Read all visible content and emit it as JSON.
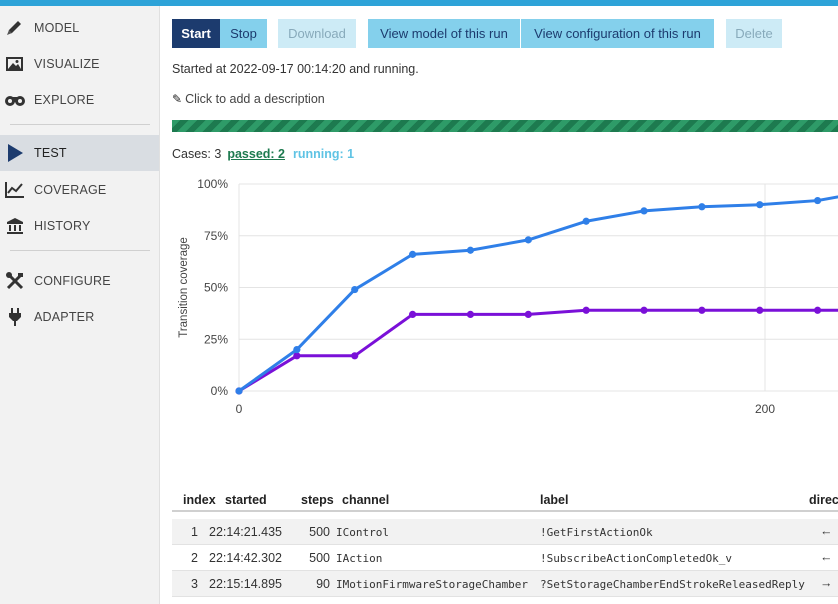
{
  "sidebar": {
    "items": [
      {
        "label": "MODEL",
        "icon": "pencil-icon"
      },
      {
        "label": "VISUALIZE",
        "icon": "image-icon"
      },
      {
        "label": "EXPLORE",
        "icon": "binoculars-icon"
      },
      {
        "label": "TEST",
        "icon": "play-icon",
        "active": true
      },
      {
        "label": "COVERAGE",
        "icon": "line-chart-icon"
      },
      {
        "label": "HISTORY",
        "icon": "bank-icon"
      },
      {
        "label": "CONFIGURE",
        "icon": "tools-icon"
      },
      {
        "label": "ADAPTER",
        "icon": "plug-icon"
      }
    ]
  },
  "toolbar": {
    "start": "Start",
    "stop": "Stop",
    "download": "Download",
    "view_model": "View model of this run",
    "view_config": "View configuration of this run",
    "delete": "Delete"
  },
  "status": "Started at 2022-09-17 00:14:20 and running.",
  "description_prompt": "Click to add a description",
  "cases": {
    "label": "Cases: 3",
    "passed": "passed: 2",
    "running": "running: 1"
  },
  "colors": {
    "accent": "#1c3b6e",
    "button_light": "#84d0ec",
    "progress": "#2e9b68",
    "series_1": "#2f7fe8",
    "series_2": "#7a10d8"
  },
  "chart_data": {
    "type": "line",
    "ylabel": "Transition coverage",
    "xlabel": "",
    "y_ticks": [
      "100%",
      "75%",
      "50%",
      "25%",
      "0%"
    ],
    "x_ticks": [
      0,
      200
    ],
    "ylim": [
      0,
      100
    ],
    "grid": true,
    "series": [
      {
        "x": [
          0,
          22,
          44,
          66,
          88,
          110,
          132,
          154,
          176,
          198,
          220,
          242
        ],
        "y": [
          0,
          20,
          49,
          66,
          68,
          73,
          82,
          87,
          89,
          90,
          92,
          97
        ]
      },
      {
        "x": [
          0,
          22,
          44,
          66,
          88,
          110,
          132,
          154,
          176,
          198,
          220,
          242
        ],
        "y": [
          0,
          17,
          17,
          37,
          37,
          37,
          39,
          39,
          39,
          39,
          39,
          39
        ]
      }
    ]
  },
  "table": {
    "headers": [
      "index",
      "started",
      "steps",
      "channel",
      "label",
      "direc"
    ],
    "rows": [
      {
        "index": "1",
        "started": "22:14:21.435",
        "steps": "500",
        "channel": "IControl",
        "label": "!GetFirstActionOk",
        "direction": "←"
      },
      {
        "index": "2",
        "started": "22:14:42.302",
        "steps": "500",
        "channel": "IAction",
        "label": "!SubscribeActionCompletedOk_v",
        "direction": "←"
      },
      {
        "index": "3",
        "started": "22:15:14.895",
        "steps": "90",
        "channel": "IMotionFirmwareStorageChamber",
        "label": "?SetStorageChamberEndStrokeReleasedReply",
        "direction": "→"
      }
    ]
  }
}
